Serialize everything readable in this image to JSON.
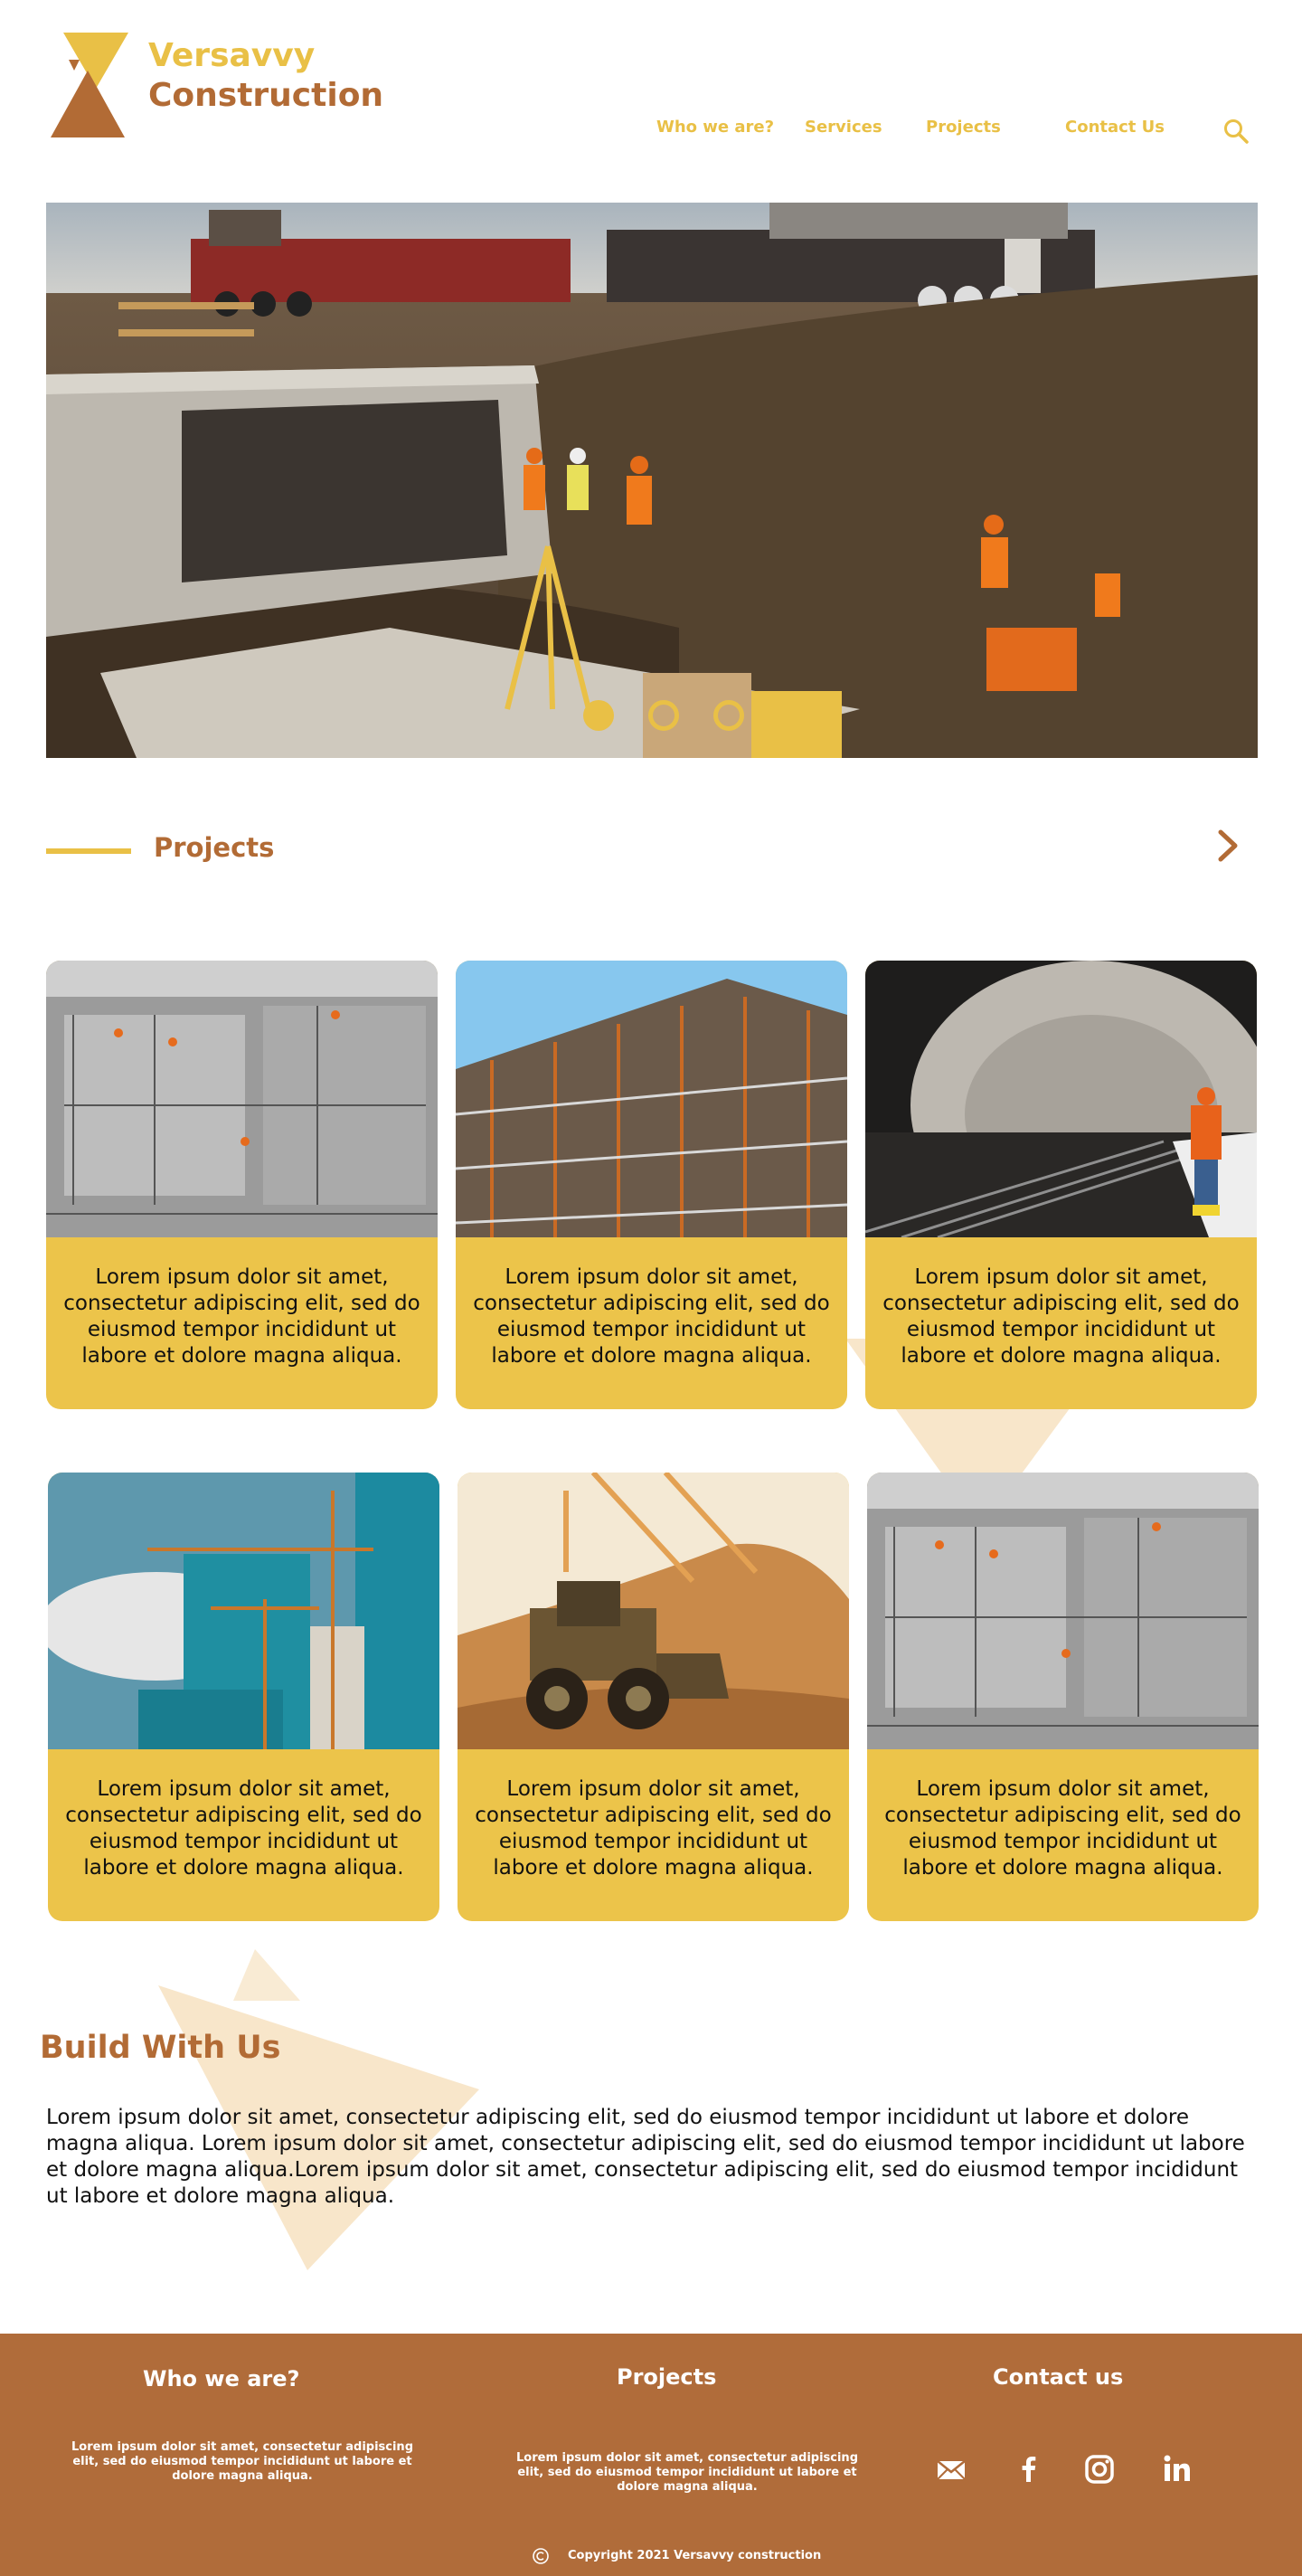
{
  "brand": {
    "line1": "Versavvy",
    "line2": "Construction"
  },
  "nav": {
    "items": [
      {
        "label": "Who we are?"
      },
      {
        "label": "Services"
      },
      {
        "label": "Projects"
      },
      {
        "label": "Contact Us"
      }
    ],
    "search_icon": "search-icon"
  },
  "hero": {
    "slide_count": 3,
    "active_slide": 1
  },
  "projects": {
    "title": "Projects",
    "next_icon": "chevron-right-icon",
    "cards": [
      {
        "image": "aerial-construction-site-photo",
        "text": "Lorem ipsum dolor sit amet, consectetur adipiscing elit, sed do eiusmod tempor incididunt ut labore et dolore magna aliqua."
      },
      {
        "image": "building-frame-photo",
        "text": "Lorem ipsum dolor sit amet, consectetur adipiscing elit, sed do eiusmod tempor incididunt ut labore et dolore magna aliqua."
      },
      {
        "image": "tunnel-worker-photo",
        "text": "Lorem ipsum dolor sit amet, consectetur adipiscing elit, sed do eiusmod tempor incididunt ut labore et dolore magna aliqua."
      },
      {
        "image": "tower-cranes-photo",
        "text": "Lorem ipsum dolor sit amet, consectetur adipiscing elit, sed do eiusmod tempor incididunt ut labore et dolore magna aliqua."
      },
      {
        "image": "wheel-loader-photo",
        "text": "Lorem ipsum dolor sit amet, consectetur adipiscing elit, sed do eiusmod tempor incididunt ut labore et dolore magna aliqua."
      },
      {
        "image": "aerial-construction-site-photo",
        "text": "Lorem ipsum dolor sit amet, consectetur adipiscing elit, sed do eiusmod tempor incididunt ut labore et dolore magna aliqua."
      }
    ]
  },
  "build": {
    "title": "Build With Us",
    "body": "Lorem ipsum dolor sit amet, consectetur adipiscing elit, sed do eiusmod tempor incididunt ut labore et dolore magna aliqua. Lorem ipsum dolor sit amet, consectetur adipiscing elit, sed do eiusmod tempor incididunt ut labore et dolore magna aliqua.Lorem ipsum dolor sit amet, consectetur adipiscing elit, sed do eiusmod tempor incididunt ut labore et dolore magna aliqua."
  },
  "footer": {
    "who_title": "Who we are?",
    "who_text": "Lorem ipsum dolor sit amet, consectetur adipiscing elit, sed do eiusmod tempor incididunt ut labore et dolore magna aliqua.",
    "projects_title": "Projects",
    "projects_text": "Lorem ipsum dolor sit amet, consectetur adipiscing elit, sed do eiusmod tempor incididunt ut labore et dolore magna aliqua.",
    "contact_title": "Contact us",
    "social_icons": [
      "mail-icon",
      "facebook-icon",
      "instagram-icon",
      "linkedin-icon"
    ],
    "copyright": "Copyright 2021 Versavvy construction"
  },
  "colors": {
    "accent": "#e9c046",
    "brand_brown": "#b26b35",
    "footer_bg": "#b06c3a",
    "card_bg": "#ecc44a"
  }
}
